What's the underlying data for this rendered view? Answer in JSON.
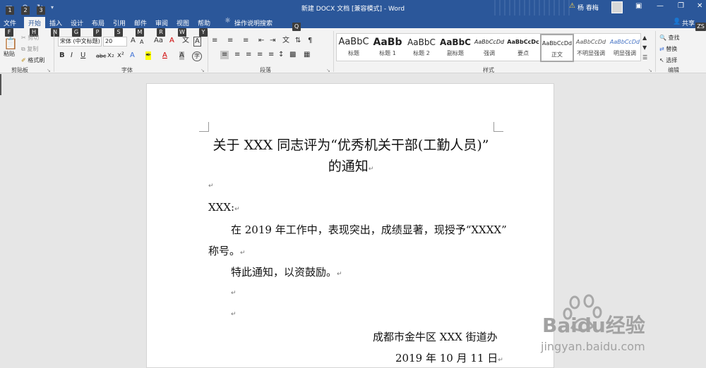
{
  "titlebar": {
    "title": "新建 DOCX 文档 [兼容模式] - Word",
    "user": "杨 春梅",
    "quick_access_keytips": [
      "1",
      "2",
      "3"
    ]
  },
  "tabs": [
    {
      "label": "文件",
      "keytip": "F"
    },
    {
      "label": "开始",
      "keytip": "H",
      "active": true
    },
    {
      "label": "插入",
      "keytip": "N"
    },
    {
      "label": "设计",
      "keytip": "G"
    },
    {
      "label": "布局",
      "keytip": "P"
    },
    {
      "label": "引用",
      "keytip": "S"
    },
    {
      "label": "邮件",
      "keytip": "M"
    },
    {
      "label": "审阅",
      "keytip": "R"
    },
    {
      "label": "视图",
      "keytip": "W"
    },
    {
      "label": "帮助",
      "keytip": "Y"
    }
  ],
  "tell_me": {
    "label": "操作说明搜索",
    "keytip": "Q"
  },
  "share": {
    "label": "共享",
    "keytip": "ZS"
  },
  "clipboard": {
    "paste": "粘贴",
    "cut": "剪切",
    "copy": "复制",
    "format_painter": "格式刷",
    "group": "剪贴板"
  },
  "font": {
    "name": "宋体 (中文标题)",
    "size": "20",
    "grow": "A",
    "shrink": "A",
    "case": "Aa",
    "clear": "A",
    "bold": "B",
    "italic": "I",
    "underline": "U",
    "strike": "abc",
    "subscript": "x₂",
    "superscript": "x²",
    "group": "字体"
  },
  "paragraph": {
    "group": "段落"
  },
  "styles": {
    "group": "样式",
    "items": [
      {
        "preview": "AaBbC",
        "label": "标题"
      },
      {
        "preview": "AaBb",
        "label": "标题 1"
      },
      {
        "preview": "AaBbC",
        "label": "标题 2"
      },
      {
        "preview": "AaBbC",
        "label": "副标题"
      },
      {
        "preview": "AaBbCcDd",
        "label": "强调"
      },
      {
        "preview": "AaBbCcDc",
        "label": "要点"
      },
      {
        "preview": "AaBbCcDd",
        "label": "正文"
      },
      {
        "preview": "AaBbCcDd",
        "label": "不明显强调"
      },
      {
        "preview": "AaBbCcDd",
        "label": "明显强调"
      }
    ]
  },
  "editing": {
    "find": "查找",
    "replace": "替换",
    "select": "选择",
    "group": "编辑"
  },
  "document": {
    "title_line1": "关于 XXX 同志评为“优秀机关干部(工勤人员)”",
    "title_line2": "的通知",
    "salutation": "XXX:",
    "body_line1": "在 2019 年工作中，表现突出，成绩显著，现授予“XXXX”",
    "body_line2": "称号。",
    "notice": "特此通知，以资鼓励。",
    "signature": "成都市金牛区 XXX 街道办",
    "date": "2019 年 10 月 11 日"
  },
  "watermark": {
    "brand": "Baidu经验",
    "url": "jingyan.baidu.com"
  }
}
